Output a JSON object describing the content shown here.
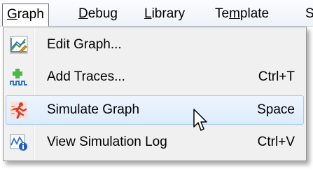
{
  "menubar": {
    "items": [
      {
        "pre": "",
        "u": "G",
        "post": "raph"
      },
      {
        "pre": "",
        "u": "D",
        "post": "ebug"
      },
      {
        "pre": "",
        "u": "L",
        "post": "ibrary"
      },
      {
        "pre": "Te",
        "u": "m",
        "post": "plate"
      },
      {
        "pre": "",
        "u": "",
        "post": "S"
      }
    ]
  },
  "menu": {
    "items": [
      {
        "label": "Edit Graph...",
        "shortcut": "",
        "icon": "edit-graph-icon"
      },
      {
        "label": "Add Traces...",
        "shortcut": "Ctrl+T",
        "icon": "add-traces-icon"
      },
      {
        "label": "Simulate Graph",
        "shortcut": "Space",
        "icon": "simulate-runner-icon"
      },
      {
        "label": "View Simulation Log",
        "shortcut": "Ctrl+V",
        "icon": "simulation-log-icon"
      }
    ]
  },
  "colors": {
    "highlight_fill": "#dcebfc",
    "highlight_border": "#a8caf0",
    "menu_background": "#f0f0f0"
  }
}
